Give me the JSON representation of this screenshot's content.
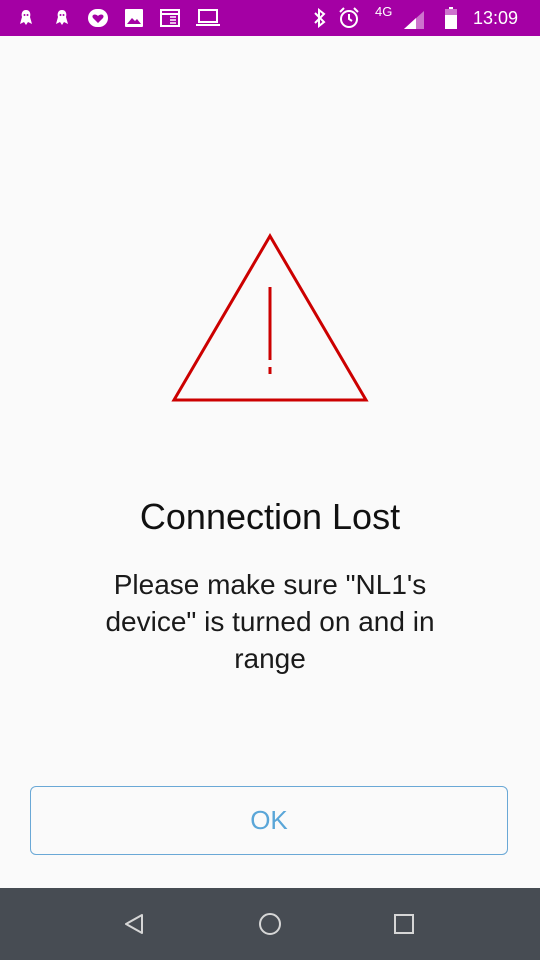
{
  "status_bar": {
    "notification_icons": [
      "ghost-icon",
      "ghost-icon",
      "heart-app-icon",
      "image-icon",
      "calendar-icon",
      "laptop-icon"
    ],
    "system_icons": [
      "bluetooth-icon",
      "alarm-icon",
      "signal-icon",
      "battery-icon"
    ],
    "network": "4G",
    "time": "13:09",
    "background_color": "#a400a4"
  },
  "dialog": {
    "icon": "warning-triangle-icon",
    "icon_color": "#cc0000",
    "title": "Connection Lost",
    "message": "Please make sure \"NL1's device\" is turned on and in range",
    "ok_label": "OK"
  },
  "nav_bar": {
    "buttons": [
      "back-icon",
      "home-icon",
      "recents-icon"
    ],
    "background_color": "#474c53"
  }
}
